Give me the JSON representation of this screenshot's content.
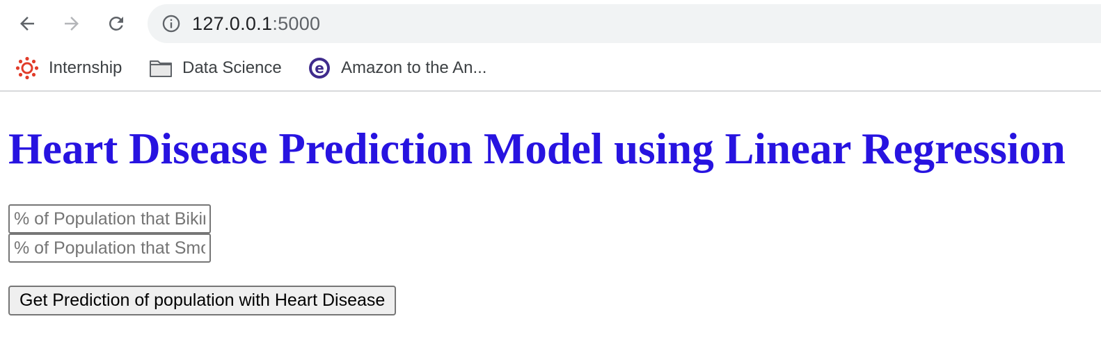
{
  "browser": {
    "url_host": "127.0.0.1",
    "url_port": ":5000",
    "bookmarks": [
      {
        "label": "Internship",
        "icon": "canvas-logo-icon"
      },
      {
        "label": "Data Science",
        "icon": "folder-icon"
      },
      {
        "label": "Amazon to the An...",
        "icon": "site-logo-icon"
      }
    ],
    "colors": {
      "omnibox_bg": "#f1f3f4",
      "canvas_red": "#e13c2a",
      "logo_purple": "#3f2b8c"
    }
  },
  "page": {
    "title": "Heart Disease Prediction Model using Linear Regression",
    "title_color": "#2713e0",
    "inputs": [
      {
        "placeholder": "% of Population that Biking",
        "value": ""
      },
      {
        "placeholder": "% of Population that Smoking",
        "value": ""
      }
    ],
    "button_label": "Get Prediction of population with Heart Disease"
  }
}
